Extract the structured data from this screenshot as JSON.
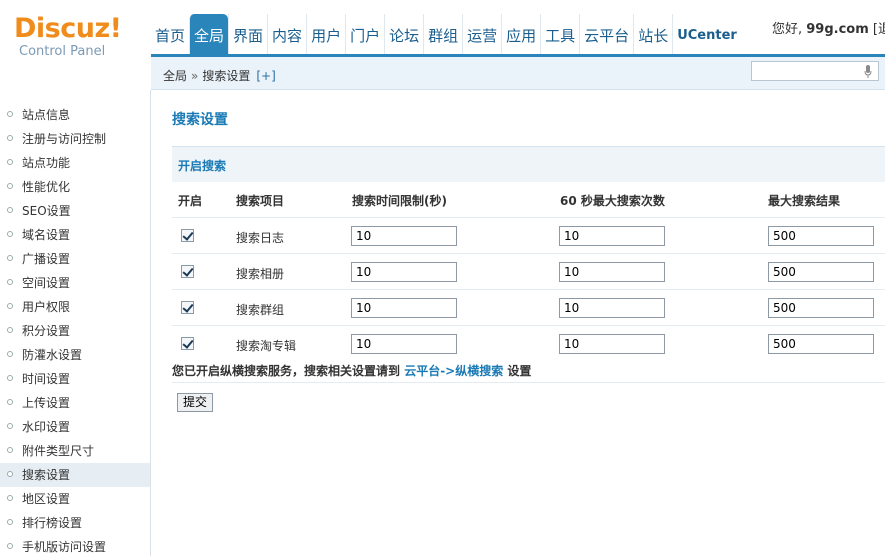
{
  "logo": {
    "main": "Discuz!",
    "sub": "Control Panel"
  },
  "greeting": {
    "prefix": "您好, ",
    "user": "99g.com",
    "suffix": " [退"
  },
  "nav": [
    {
      "label": "首页",
      "active": false
    },
    {
      "label": "全局",
      "active": true
    },
    {
      "label": "界面",
      "active": false
    },
    {
      "label": "内容",
      "active": false
    },
    {
      "label": "用户",
      "active": false
    },
    {
      "label": "门户",
      "active": false
    },
    {
      "label": "论坛",
      "active": false
    },
    {
      "label": "群组",
      "active": false
    },
    {
      "label": "运营",
      "active": false
    },
    {
      "label": "应用",
      "active": false
    },
    {
      "label": "工具",
      "active": false
    },
    {
      "label": "云平台",
      "active": false
    },
    {
      "label": "站长",
      "active": false
    },
    {
      "label": "UCenter",
      "active": false
    }
  ],
  "breadcrumb": {
    "root": "全局",
    "sep": "»",
    "current": "搜索设置",
    "add": "[+]"
  },
  "search": {
    "placeholder": ""
  },
  "sidebar": {
    "items": [
      "站点信息",
      "注册与访问控制",
      "站点功能",
      "性能优化",
      "SEO设置",
      "域名设置",
      "广播设置",
      "空间设置",
      "用户权限",
      "积分设置",
      "防灌水设置",
      "时间设置",
      "上传设置",
      "水印设置",
      "附件类型尺寸",
      "搜索设置",
      "地区设置",
      "排行榜设置",
      "手机版访问设置"
    ],
    "active_index": 15
  },
  "page": {
    "title": "搜索设置",
    "section": "开启搜索",
    "headers": {
      "enable": "开启",
      "item": "搜索项目",
      "time_limit": "搜索时间限制(秒)",
      "max_count": "60 秒最大搜索次数",
      "max_results": "最大搜索结果"
    },
    "rows": [
      {
        "checked": true,
        "name": "搜索日志",
        "time_limit": "10",
        "max_count": "10",
        "max_results": "500"
      },
      {
        "checked": true,
        "name": "搜索相册",
        "time_limit": "10",
        "max_count": "10",
        "max_results": "500"
      },
      {
        "checked": true,
        "name": "搜索群组",
        "time_limit": "10",
        "max_count": "10",
        "max_results": "500"
      },
      {
        "checked": true,
        "name": "搜索淘专辑",
        "time_limit": "10",
        "max_count": "10",
        "max_results": "500"
      }
    ],
    "note": {
      "prefix": "您已开启纵横搜索服务，搜索相关设置请到 ",
      "link": "云平台->纵横搜索",
      "suffix": " 设置"
    },
    "submit_label": "提交"
  },
  "colors": {
    "accent": "#2a86ba",
    "logo": "#f08c1c",
    "link": "#1a7ab5"
  }
}
